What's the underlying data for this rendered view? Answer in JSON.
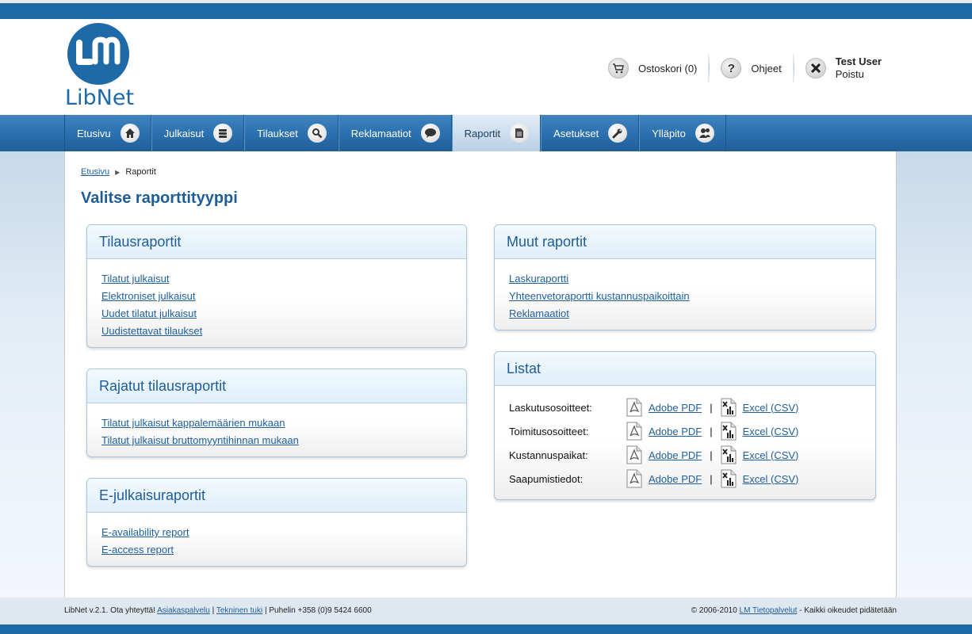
{
  "brand": {
    "logo_text": "LibNet",
    "logo_mark": "LM",
    "color_primary": "#1e6aa8"
  },
  "header": {
    "cart_label": "Ostoskori (0)",
    "help_label": "Ohjeet",
    "user_name": "Test User",
    "logout_label": "Poistu"
  },
  "nav": {
    "items": [
      {
        "label": "Etusivu",
        "icon": "home-icon"
      },
      {
        "label": "Julkaisut",
        "icon": "stack-icon"
      },
      {
        "label": "Tilaukset",
        "icon": "search-icon"
      },
      {
        "label": "Reklamaatiot",
        "icon": "speech-bubble-icon"
      },
      {
        "label": "Raportit",
        "icon": "document-icon",
        "active": true
      },
      {
        "label": "Asetukset",
        "icon": "wrench-icon"
      },
      {
        "label": "Ylläpito",
        "icon": "users-icon"
      }
    ]
  },
  "breadcrumb": {
    "home": "Etusivu",
    "current": "Raportit"
  },
  "page_title": "Valitse raporttityyppi",
  "panels": {
    "tilaus": {
      "title": "Tilausraportit",
      "links": [
        "Tilatut julkaisut",
        "Elektroniset julkaisut",
        "Uudet tilatut julkaisut",
        "Uudistettavat tilaukset"
      ]
    },
    "rajatut": {
      "title": "Rajatut tilausraportit",
      "links": [
        "Tilatut julkaisut kappalemäärien mukaan",
        "Tilatut julkaisut bruttomyyntihinnan mukaan"
      ]
    },
    "ejulkaisu": {
      "title": "E-julkaisuraportit",
      "links": [
        "E-availability report",
        "E-access report"
      ]
    },
    "muut": {
      "title": "Muut raportit",
      "links": [
        "Laskuraportti",
        "Yhteenvetoraportti kustannuspaikoittain",
        "Reklamaatiot"
      ]
    },
    "listat": {
      "title": "Listat",
      "pdf_label": "Adobe PDF",
      "excel_label": "Excel (CSV)",
      "separator": "|",
      "rows": [
        "Laskutusosoitteet:",
        "Toimitusosoitteet:",
        "Kustannuspaikat:",
        "Saapumistiedot:"
      ]
    }
  },
  "footer": {
    "version_text": "LibNet v.2.1. Ota yhteyttä!",
    "customer_service": "Asiakaspalvelu",
    "tech_support": "Tekninen tuki",
    "phone": "| Puhelin +358 (0)9 5424 6600",
    "copyright": "© 2006-2010",
    "company": "LM Tietopalvelut",
    "rights": "- Kaikki oikeudet pidätetään"
  }
}
